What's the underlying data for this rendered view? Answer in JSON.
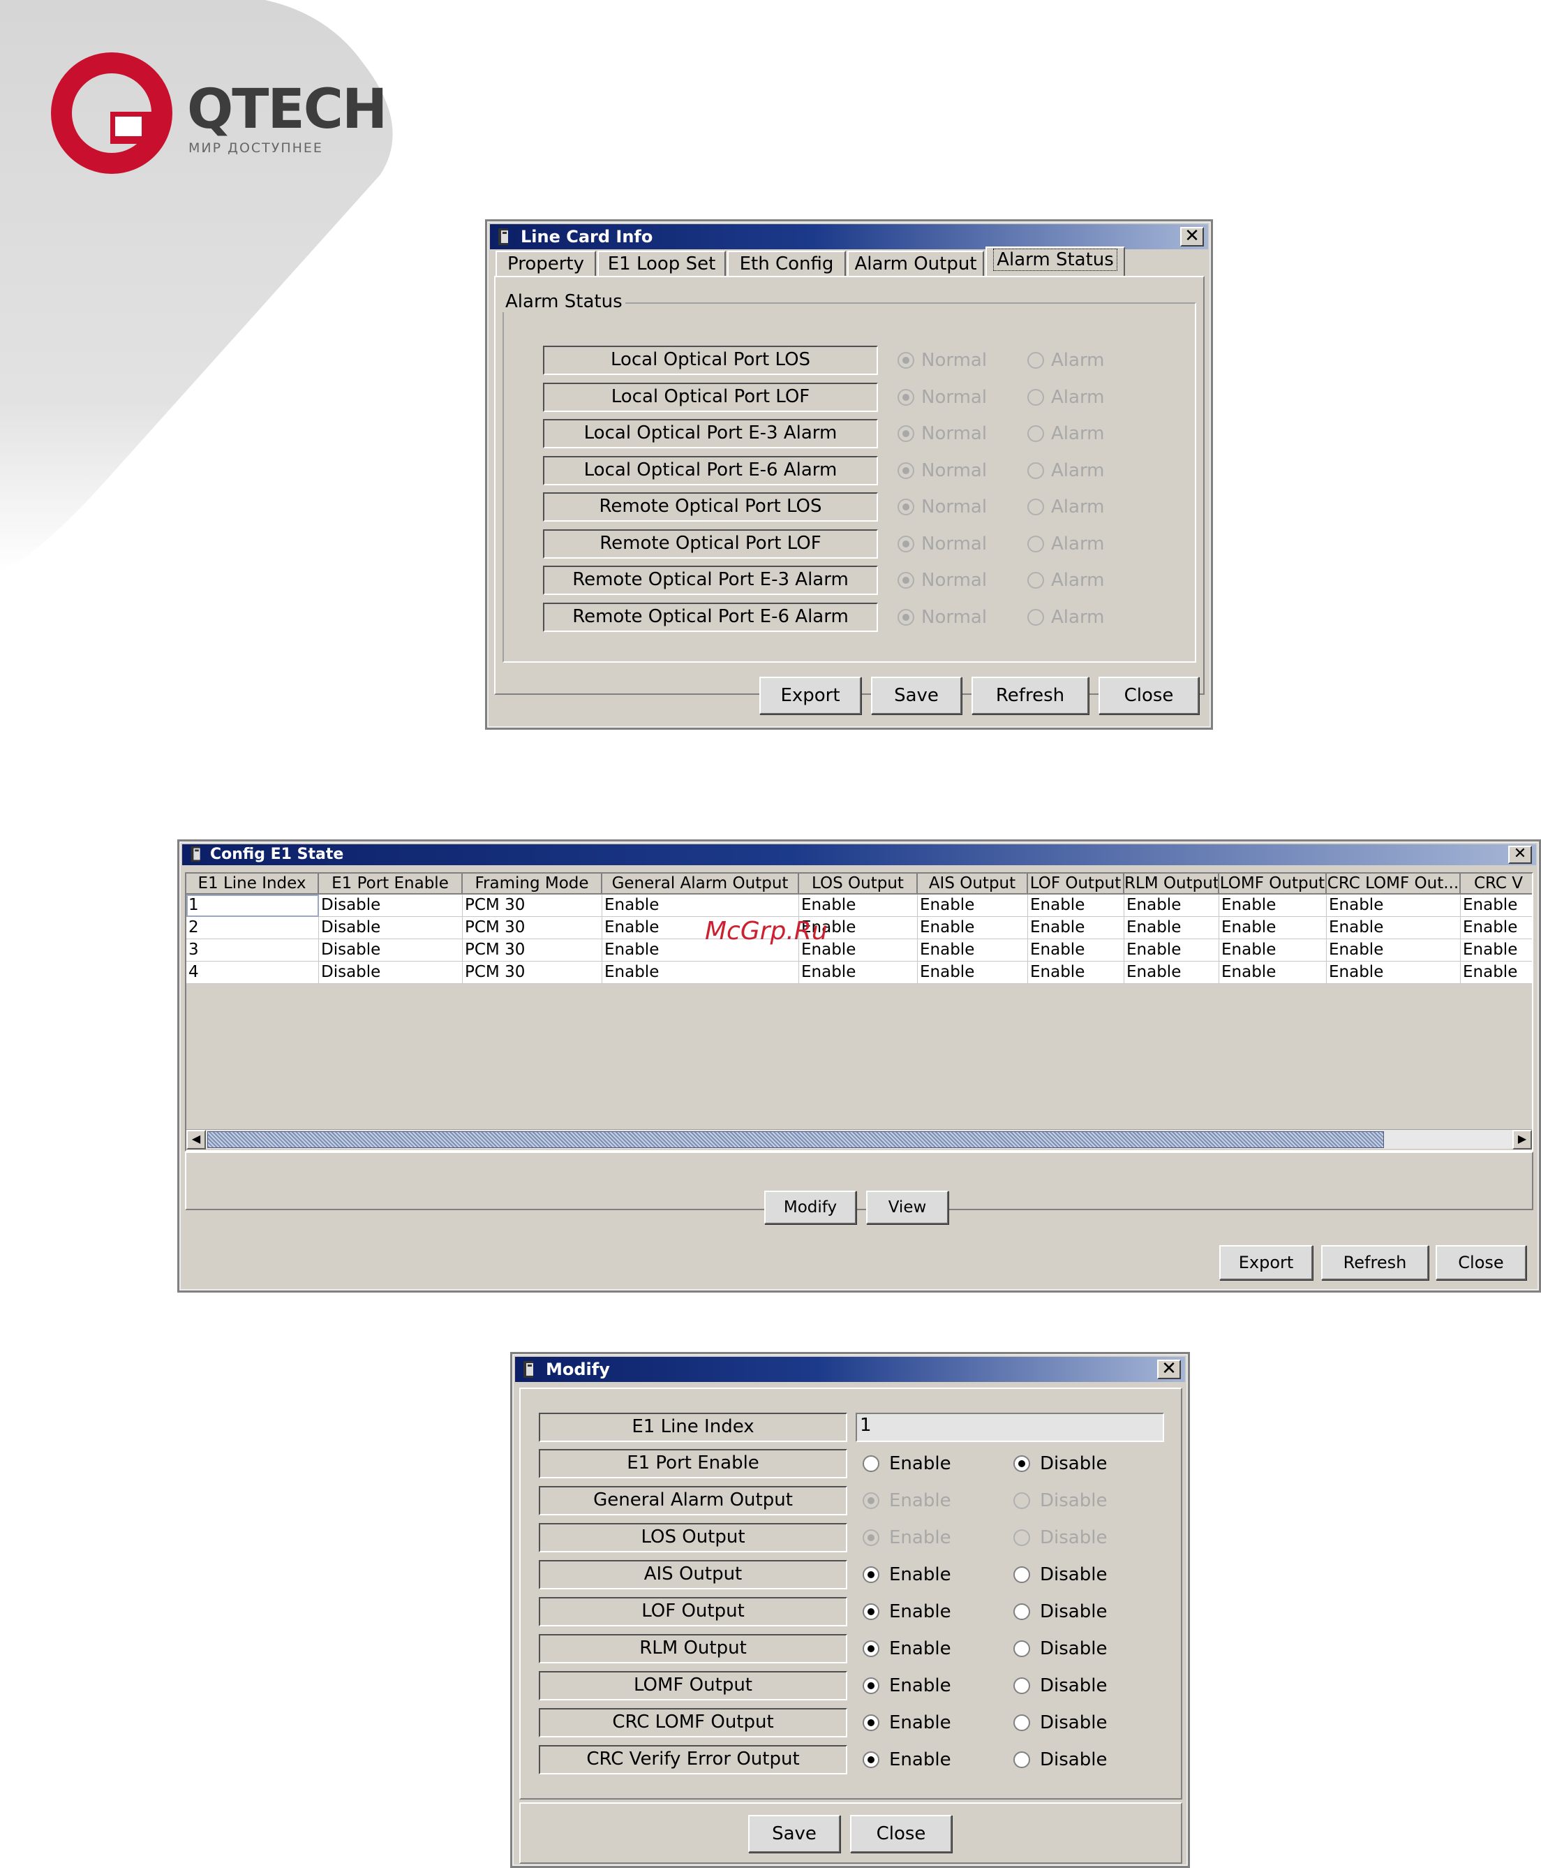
{
  "logo": {
    "brand": "QTECH",
    "tagline": "МИР ДОСТУПНЕЕ"
  },
  "watermark": "McGrp.Ru",
  "line_card": {
    "title": "Line Card Info",
    "tabs": [
      "Property",
      "E1 Loop Set",
      "Eth Config",
      "Alarm Output",
      "Alarm Status"
    ],
    "active_tab": "Alarm Status",
    "group_title": "Alarm Status",
    "rows": [
      {
        "label": "Local Optical Port LOS",
        "normal": "Normal",
        "alarm": "Alarm"
      },
      {
        "label": "Local Optical Port LOF",
        "normal": "Normal",
        "alarm": "Alarm"
      },
      {
        "label": "Local Optical Port E-3 Alarm",
        "normal": "Normal",
        "alarm": "Alarm"
      },
      {
        "label": "Local Optical Port E-6 Alarm",
        "normal": "Normal",
        "alarm": "Alarm"
      },
      {
        "label": "Remote Optical Port LOS",
        "normal": "Normal",
        "alarm": "Alarm"
      },
      {
        "label": "Remote Optical Port LOF",
        "normal": "Normal",
        "alarm": "Alarm"
      },
      {
        "label": "Remote Optical Port E-3 Alarm",
        "normal": "Normal",
        "alarm": "Alarm"
      },
      {
        "label": "Remote Optical Port E-6 Alarm",
        "normal": "Normal",
        "alarm": "Alarm"
      }
    ],
    "buttons": {
      "export": "Export",
      "save": "Save",
      "refresh": "Refresh",
      "close": "Close"
    }
  },
  "config_e1": {
    "title": "Config E1 State",
    "columns": [
      "E1 Line Index",
      "E1 Port Enable",
      "Framing Mode",
      "General Alarm Output",
      "LOS Output",
      "AIS Output",
      "LOF Output",
      "RLM Output",
      "LOMF Output",
      "CRC LOMF Out...",
      "CRC V"
    ],
    "rows": [
      [
        "1",
        "Disable",
        "PCM 30",
        "Enable",
        "Enable",
        "Enable",
        "Enable",
        "Enable",
        "Enable",
        "Enable",
        "Enable"
      ],
      [
        "2",
        "Disable",
        "PCM 30",
        "Enable",
        "Enable",
        "Enable",
        "Enable",
        "Enable",
        "Enable",
        "Enable",
        "Enable"
      ],
      [
        "3",
        "Disable",
        "PCM 30",
        "Enable",
        "Enable",
        "Enable",
        "Enable",
        "Enable",
        "Enable",
        "Enable",
        "Enable"
      ],
      [
        "4",
        "Disable",
        "PCM 30",
        "Enable",
        "Enable",
        "Enable",
        "Enable",
        "Enable",
        "Enable",
        "Enable",
        "Enable"
      ]
    ],
    "buttons": {
      "modify": "Modify",
      "view": "View",
      "export": "Export",
      "refresh": "Refresh",
      "close": "Close"
    }
  },
  "modify": {
    "title": "Modify",
    "index_label": "E1 Line Index",
    "index_value": "1",
    "rows": [
      {
        "label": "E1 Port Enable",
        "enable": "Enable",
        "disable": "Disable",
        "selected": "Disable",
        "disabled": false
      },
      {
        "label": "General Alarm Output",
        "enable": "Enable",
        "disable": "Disable",
        "selected": "Enable",
        "disabled": true
      },
      {
        "label": "LOS Output",
        "enable": "Enable",
        "disable": "Disable",
        "selected": "Enable",
        "disabled": true
      },
      {
        "label": "AIS Output",
        "enable": "Enable",
        "disable": "Disable",
        "selected": "Enable",
        "disabled": false
      },
      {
        "label": "LOF Output",
        "enable": "Enable",
        "disable": "Disable",
        "selected": "Enable",
        "disabled": false
      },
      {
        "label": "RLM Output",
        "enable": "Enable",
        "disable": "Disable",
        "selected": "Enable",
        "disabled": false
      },
      {
        "label": "LOMF Output",
        "enable": "Enable",
        "disable": "Disable",
        "selected": "Enable",
        "disabled": false
      },
      {
        "label": "CRC LOMF Output",
        "enable": "Enable",
        "disable": "Disable",
        "selected": "Enable",
        "disabled": false
      },
      {
        "label": "CRC Verify Error Output",
        "enable": "Enable",
        "disable": "Disable",
        "selected": "Enable",
        "disabled": false
      }
    ],
    "buttons": {
      "save": "Save",
      "close": "Close"
    }
  },
  "colors": {
    "titlebar": "#0c1f66",
    "logo_red": "#c8102e",
    "dialog_gray": "#d4d0c8"
  }
}
